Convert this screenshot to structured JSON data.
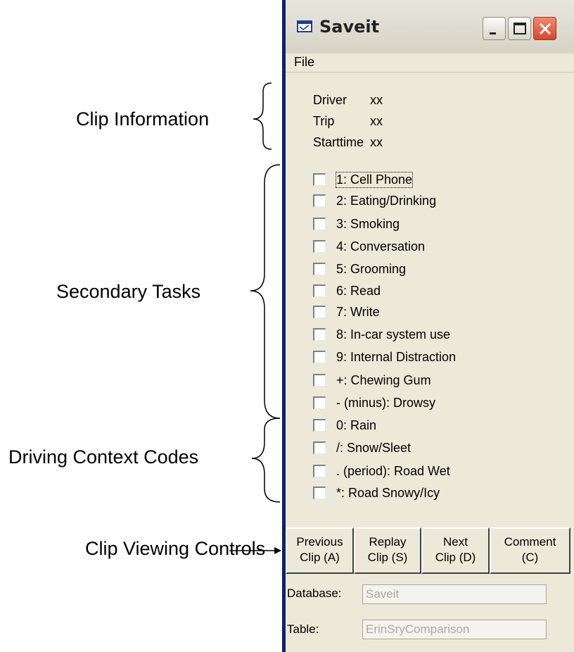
{
  "annotations": {
    "clip_information": "Clip Information",
    "secondary_tasks": "Secondary Tasks",
    "driving_context_codes": "Driving Context Codes",
    "clip_viewing_controls": "Clip Viewing Controls"
  },
  "window": {
    "title": "Saveit",
    "menu": {
      "file": "File"
    },
    "clip_info": [
      {
        "label": "Driver",
        "value": "xx"
      },
      {
        "label": "Trip",
        "value": "xx"
      },
      {
        "label": "Starttime",
        "value": "xx"
      }
    ],
    "checkboxes": [
      {
        "label": "1: Cell Phone",
        "checked": false
      },
      {
        "label": "2: Eating/Drinking",
        "checked": false
      },
      {
        "label": "3: Smoking",
        "checked": false
      },
      {
        "label": "4: Conversation",
        "checked": false
      },
      {
        "label": "5: Grooming",
        "checked": false
      },
      {
        "label": "6: Read",
        "checked": false
      },
      {
        "label": "7: Write",
        "checked": false
      },
      {
        "label": "8: In-car system use",
        "checked": false
      },
      {
        "label": "9: Internal Distraction",
        "checked": false
      },
      {
        "label": "+: Chewing Gum",
        "checked": false
      },
      {
        "label": "- (minus): Drowsy",
        "checked": false
      },
      {
        "label": "0: Rain",
        "checked": false
      },
      {
        "label": "/: Snow/Sleet",
        "checked": false
      },
      {
        "label": ". (period): Road Wet",
        "checked": false
      },
      {
        "label": "*: Road Snowy/Icy",
        "checked": false
      }
    ],
    "buttons": [
      {
        "line1": "Previous",
        "line2": "Clip (A)"
      },
      {
        "line1": "Replay",
        "line2": "Clip (S)"
      },
      {
        "line1": "Next",
        "line2": "Clip (D)"
      },
      {
        "line1": "Comment",
        "line2": "(C)"
      }
    ],
    "database": {
      "label": "Database:",
      "value": "Saveit"
    },
    "table": {
      "label": "Table:",
      "value": "ErinSryComparison"
    }
  },
  "colors": {
    "window_face": "#ece9d8",
    "close_button": "#d8472c",
    "disabled_text": "#a9a9a0"
  },
  "icons": [
    "app-window-icon",
    "minimize-icon",
    "maximize-icon",
    "close-icon",
    "arrow-icon"
  ]
}
